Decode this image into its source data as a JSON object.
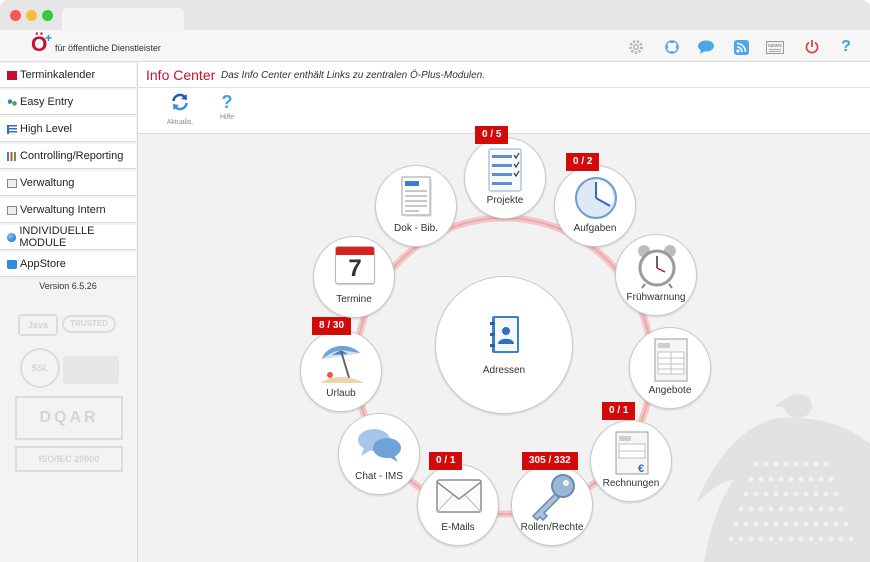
{
  "app": {
    "tagline": "für öffentliche Dienstleister",
    "logo": "Ö",
    "header_icons": [
      "gear-icon",
      "move-icon",
      "chat-bubble-icon",
      "rss-icon",
      "news-icon",
      "power-icon",
      "help-icon"
    ]
  },
  "sidebar": {
    "items": [
      {
        "label": "Terminkalender",
        "icon": "calendar-icon"
      },
      {
        "label": "Easy Entry",
        "icon": "people-icon"
      },
      {
        "label": "High Level",
        "icon": "list-icon"
      },
      {
        "label": "Controlling/Reporting",
        "icon": "bar-chart-icon"
      },
      {
        "label": "Verwaltung",
        "icon": "clipboard-icon"
      },
      {
        "label": "Verwaltung Intern",
        "icon": "clipboard-icon"
      },
      {
        "label": "INDIVIDUELLE MODULE",
        "icon": "globe-icon"
      },
      {
        "label": "AppStore",
        "icon": "bag-icon"
      }
    ],
    "version": "Version 6.5.26",
    "trust_badges": [
      "Java",
      "TRUSTED",
      "SSL",
      "DQAR",
      "ISO/IEC 20000"
    ]
  },
  "main": {
    "title": "Info Center",
    "subtitle": "Das Info Center enthält Links zu zentralen Ö-Plus-Modulen.",
    "toolbar": {
      "refresh_label": "Aktualis.",
      "help_label": "Hilfe"
    }
  },
  "hub": {
    "center": {
      "label": "Adressen",
      "icon": "address-book-icon"
    },
    "nodes": [
      {
        "key": "projekte",
        "label": "Projekte",
        "icon": "checklist-icon",
        "count": "0 / 5"
      },
      {
        "key": "aufgaben",
        "label": "Aufgaben",
        "icon": "clock-icon",
        "count": "0 / 2"
      },
      {
        "key": "fruehwarnung",
        "label": "Frühwarnung",
        "icon": "alarm-clock-icon",
        "count": ""
      },
      {
        "key": "angebote",
        "label": "Angebote",
        "icon": "invoice-icon",
        "count": ""
      },
      {
        "key": "rechnungen",
        "label": "Rechnungen",
        "icon": "euro-invoice-icon",
        "count": "0 / 1"
      },
      {
        "key": "rollen",
        "label": "Rollen/Rechte",
        "icon": "key-icon",
        "count": "305 / 332"
      },
      {
        "key": "emails",
        "label": "E-Mails",
        "icon": "envelope-icon",
        "count": "0 / 1"
      },
      {
        "key": "chat",
        "label": "Chat - IMS",
        "icon": "chat-icon",
        "count": ""
      },
      {
        "key": "urlaub",
        "label": "Urlaub",
        "icon": "beach-umbrella-icon",
        "count": "8 / 30"
      },
      {
        "key": "termine",
        "label": "Termine",
        "icon": "calendar-7-icon",
        "count": "",
        "day": "7"
      },
      {
        "key": "dokbib",
        "label": "Dok - Bib.",
        "icon": "document-icon",
        "count": ""
      }
    ]
  },
  "colors": {
    "brand_red": "#c8102e",
    "badge_red": "#d20a0a",
    "accent_blue": "#2f8be0"
  }
}
